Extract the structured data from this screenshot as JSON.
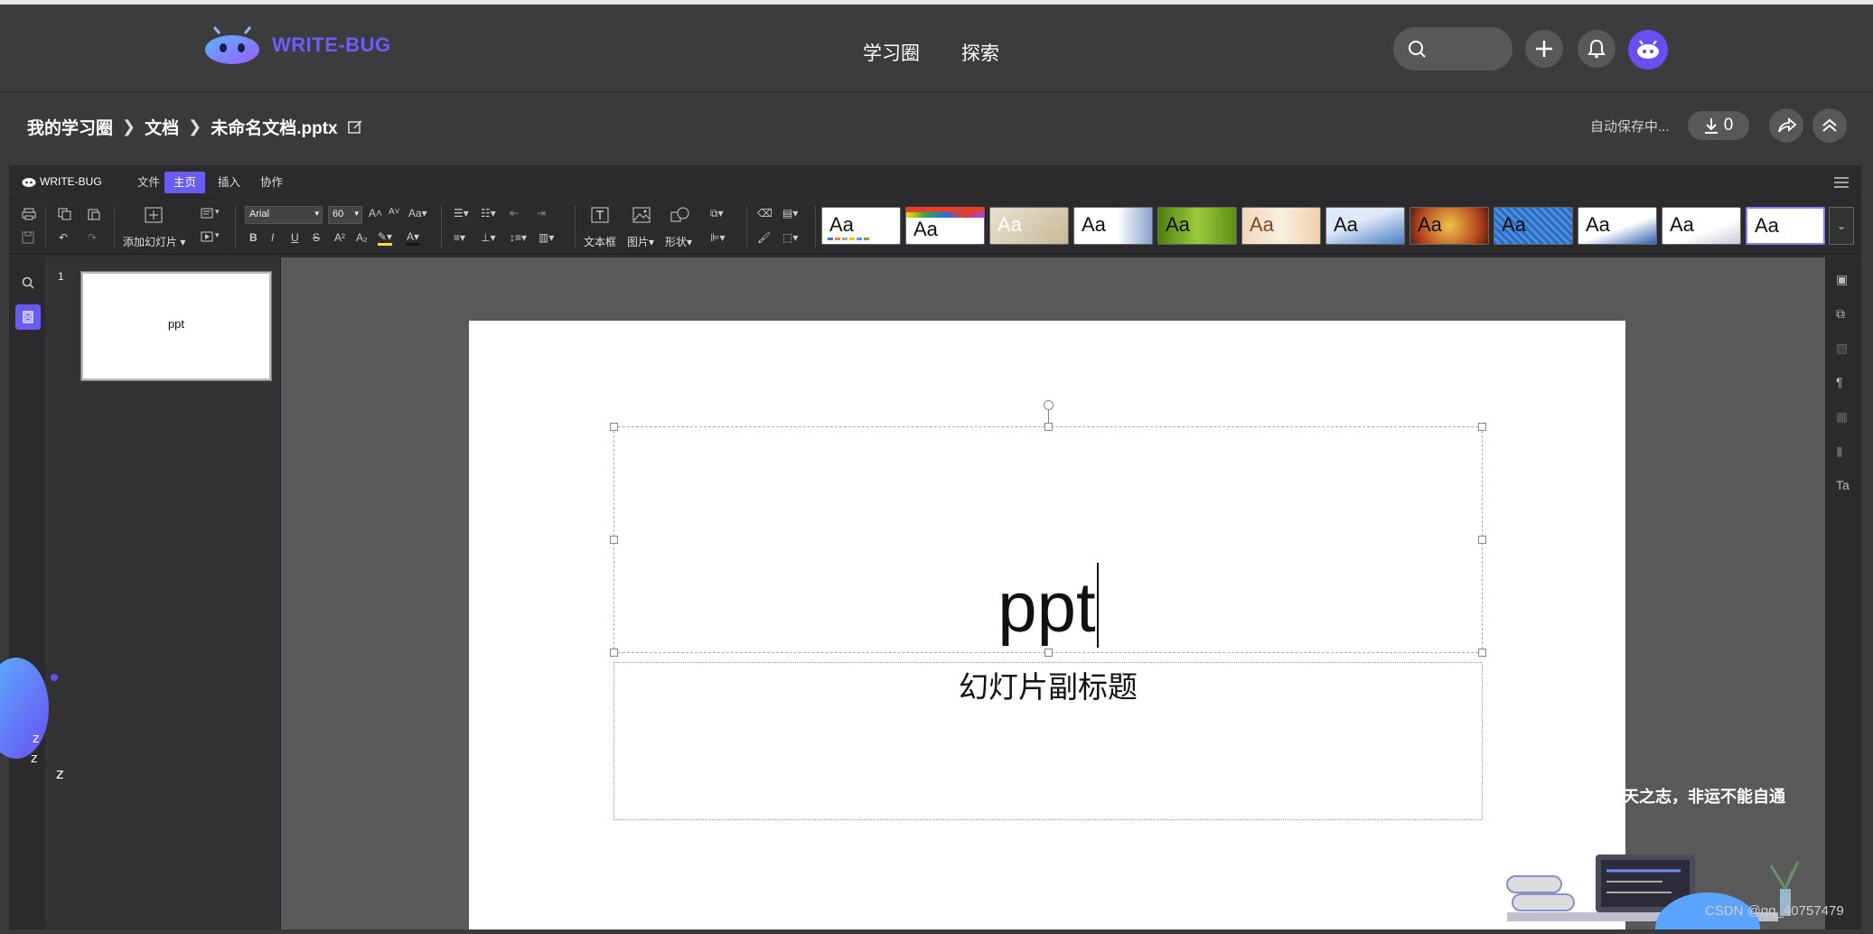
{
  "header": {
    "brand": "WRITE-BUG",
    "nav": [
      "学习圈",
      "探索"
    ],
    "colors": {
      "brand": "#6e5df7",
      "avatar": "#6b4ef2"
    }
  },
  "breadcrumb": {
    "items": [
      "我的学习圈",
      "文档",
      "未命名文档.pptx"
    ],
    "autosave": "自动保存中...",
    "download_count": "0"
  },
  "menubar": {
    "brand": "WRITE-BUG",
    "items": [
      "文件",
      "主页",
      "插入",
      "协作"
    ],
    "active": "主页"
  },
  "ribbon": {
    "add_slide": "添加幻灯片",
    "font": "Arial",
    "font_size": "60",
    "textbox": "文本框",
    "picture": "图片",
    "shape": "形状",
    "theme_label": "Aa"
  },
  "slides_panel": {
    "slide_number": "1",
    "thumb_text": "ppt"
  },
  "slide": {
    "title": "ppt",
    "subtitle": "幻灯片副标题"
  },
  "overlay": {
    "motto": "天之志，非运不能自通",
    "watermark": "CSDN @qq_40757479"
  }
}
